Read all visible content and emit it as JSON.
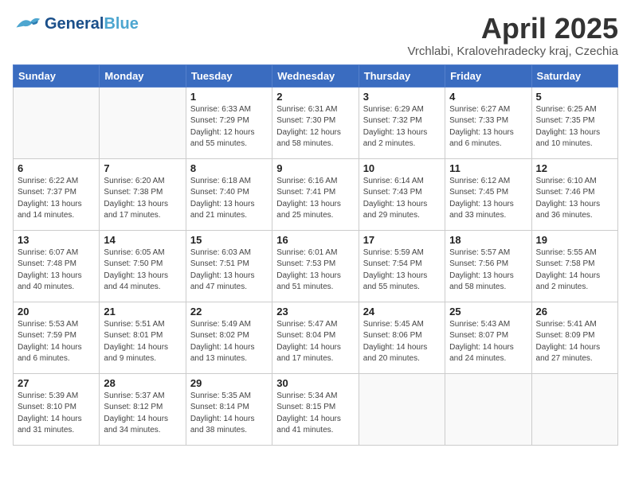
{
  "header": {
    "logo_line1": "General",
    "logo_line2": "Blue",
    "title": "April 2025",
    "subtitle": "Vrchlabi, Kralovehradecky kraj, Czechia"
  },
  "days_of_week": [
    "Sunday",
    "Monday",
    "Tuesday",
    "Wednesday",
    "Thursday",
    "Friday",
    "Saturday"
  ],
  "weeks": [
    [
      {
        "day": "",
        "info": ""
      },
      {
        "day": "",
        "info": ""
      },
      {
        "day": "1",
        "info": "Sunrise: 6:33 AM\nSunset: 7:29 PM\nDaylight: 12 hours\nand 55 minutes."
      },
      {
        "day": "2",
        "info": "Sunrise: 6:31 AM\nSunset: 7:30 PM\nDaylight: 12 hours\nand 58 minutes."
      },
      {
        "day": "3",
        "info": "Sunrise: 6:29 AM\nSunset: 7:32 PM\nDaylight: 13 hours\nand 2 minutes."
      },
      {
        "day": "4",
        "info": "Sunrise: 6:27 AM\nSunset: 7:33 PM\nDaylight: 13 hours\nand 6 minutes."
      },
      {
        "day": "5",
        "info": "Sunrise: 6:25 AM\nSunset: 7:35 PM\nDaylight: 13 hours\nand 10 minutes."
      }
    ],
    [
      {
        "day": "6",
        "info": "Sunrise: 6:22 AM\nSunset: 7:37 PM\nDaylight: 13 hours\nand 14 minutes."
      },
      {
        "day": "7",
        "info": "Sunrise: 6:20 AM\nSunset: 7:38 PM\nDaylight: 13 hours\nand 17 minutes."
      },
      {
        "day": "8",
        "info": "Sunrise: 6:18 AM\nSunset: 7:40 PM\nDaylight: 13 hours\nand 21 minutes."
      },
      {
        "day": "9",
        "info": "Sunrise: 6:16 AM\nSunset: 7:41 PM\nDaylight: 13 hours\nand 25 minutes."
      },
      {
        "day": "10",
        "info": "Sunrise: 6:14 AM\nSunset: 7:43 PM\nDaylight: 13 hours\nand 29 minutes."
      },
      {
        "day": "11",
        "info": "Sunrise: 6:12 AM\nSunset: 7:45 PM\nDaylight: 13 hours\nand 33 minutes."
      },
      {
        "day": "12",
        "info": "Sunrise: 6:10 AM\nSunset: 7:46 PM\nDaylight: 13 hours\nand 36 minutes."
      }
    ],
    [
      {
        "day": "13",
        "info": "Sunrise: 6:07 AM\nSunset: 7:48 PM\nDaylight: 13 hours\nand 40 minutes."
      },
      {
        "day": "14",
        "info": "Sunrise: 6:05 AM\nSunset: 7:50 PM\nDaylight: 13 hours\nand 44 minutes."
      },
      {
        "day": "15",
        "info": "Sunrise: 6:03 AM\nSunset: 7:51 PM\nDaylight: 13 hours\nand 47 minutes."
      },
      {
        "day": "16",
        "info": "Sunrise: 6:01 AM\nSunset: 7:53 PM\nDaylight: 13 hours\nand 51 minutes."
      },
      {
        "day": "17",
        "info": "Sunrise: 5:59 AM\nSunset: 7:54 PM\nDaylight: 13 hours\nand 55 minutes."
      },
      {
        "day": "18",
        "info": "Sunrise: 5:57 AM\nSunset: 7:56 PM\nDaylight: 13 hours\nand 58 minutes."
      },
      {
        "day": "19",
        "info": "Sunrise: 5:55 AM\nSunset: 7:58 PM\nDaylight: 14 hours\nand 2 minutes."
      }
    ],
    [
      {
        "day": "20",
        "info": "Sunrise: 5:53 AM\nSunset: 7:59 PM\nDaylight: 14 hours\nand 6 minutes."
      },
      {
        "day": "21",
        "info": "Sunrise: 5:51 AM\nSunset: 8:01 PM\nDaylight: 14 hours\nand 9 minutes."
      },
      {
        "day": "22",
        "info": "Sunrise: 5:49 AM\nSunset: 8:02 PM\nDaylight: 14 hours\nand 13 minutes."
      },
      {
        "day": "23",
        "info": "Sunrise: 5:47 AM\nSunset: 8:04 PM\nDaylight: 14 hours\nand 17 minutes."
      },
      {
        "day": "24",
        "info": "Sunrise: 5:45 AM\nSunset: 8:06 PM\nDaylight: 14 hours\nand 20 minutes."
      },
      {
        "day": "25",
        "info": "Sunrise: 5:43 AM\nSunset: 8:07 PM\nDaylight: 14 hours\nand 24 minutes."
      },
      {
        "day": "26",
        "info": "Sunrise: 5:41 AM\nSunset: 8:09 PM\nDaylight: 14 hours\nand 27 minutes."
      }
    ],
    [
      {
        "day": "27",
        "info": "Sunrise: 5:39 AM\nSunset: 8:10 PM\nDaylight: 14 hours\nand 31 minutes."
      },
      {
        "day": "28",
        "info": "Sunrise: 5:37 AM\nSunset: 8:12 PM\nDaylight: 14 hours\nand 34 minutes."
      },
      {
        "day": "29",
        "info": "Sunrise: 5:35 AM\nSunset: 8:14 PM\nDaylight: 14 hours\nand 38 minutes."
      },
      {
        "day": "30",
        "info": "Sunrise: 5:34 AM\nSunset: 8:15 PM\nDaylight: 14 hours\nand 41 minutes."
      },
      {
        "day": "",
        "info": ""
      },
      {
        "day": "",
        "info": ""
      },
      {
        "day": "",
        "info": ""
      }
    ]
  ]
}
